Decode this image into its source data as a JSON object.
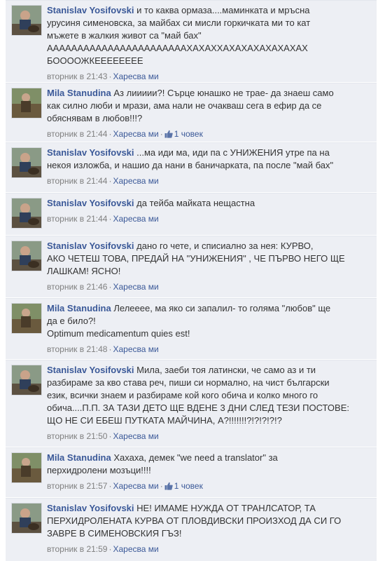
{
  "like_label": "Харесва ми",
  "comments": [
    {
      "author": "Stanislav Yosifovski",
      "lines": [
        "и то каква ормаза....маминката и мръсна",
        "урусиня сименовска, за майбах си мисли горкичката ми то кат",
        "мъжете в жалкия живот са \"май бах\"",
        "АААААААААААААААААААААААХАХАХХАХАХАХАХАХАХАХ",
        "БООООЖКЕЕЕЕЕЕЕЕ"
      ],
      "timestamp": "вторник в 21:43",
      "likes": ""
    },
    {
      "author": "Mila Stanudina",
      "lines": [
        "Аз лиииии?! Сърце юнашко не трае- да знаеш само",
        "как силно люби и мрази, ама нали не очакваш сега в ефир да се",
        "обяснявам в любов!!!?"
      ],
      "timestamp": "вторник в 21:44",
      "likes": "1 човек"
    },
    {
      "author": "Stanislav Yosifovski",
      "lines": [
        "...ма иди ма, иди па с УНИЖЕНИЯ утре па на",
        "некоя изложба, и нашио да нани в баничарката, па после \"май бах\""
      ],
      "timestamp": "вторник в 21:44",
      "likes": ""
    },
    {
      "author": "Stanislav Yosifovski",
      "lines": [
        "да тейба майката нещастна"
      ],
      "timestamp": "вторник в 21:44",
      "likes": ""
    },
    {
      "author": "Stanislav Yosifovski",
      "lines": [
        "дано го чете, и списиално за нея: КУРВО,",
        "АКО ЧЕТЕШ ТОВА, ПРЕДАЙ НА \"УНИЖЕНИЯ\" , ЧЕ ПЪРВО НЕГО ЩЕ",
        "ЛАШКАМ! ЯСНО!"
      ],
      "timestamp": "вторник в 21:46",
      "likes": ""
    },
    {
      "author": "Mila Stanudina",
      "lines": [
        "Лелееее, ма яко си запалил- то голяма \"любов\" ще",
        "да е било?!",
        "Optimum medicamentum quies est!"
      ],
      "timestamp": "вторник в 21:48",
      "likes": ""
    },
    {
      "author": "Stanislav Yosifovski",
      "lines": [
        "Мила, заеби тоя латински, че само аз и ти",
        "разбираме за кво става реч, пиши си нормално, на чист български",
        "език, всички знаем и разбираме кой кого обича и колко много го",
        "обича....П.П. ЗА ТАЗИ ДЕТО ЩЕ ВДЕНЕ 3 ДНИ СЛЕД ТЕЗИ ПОСТОВЕ:",
        "ЩО НЕ СИ ЕБЕШ ПУТКАТА МАЙЧИНА, А?!!!!!!!?!?!?!?!?"
      ],
      "timestamp": "вторник в 21:50",
      "likes": ""
    },
    {
      "author": "Mila Stanudina",
      "lines": [
        "Хахаха, демек \"we need a translator\" за",
        "перхидролени мозъци!!!!"
      ],
      "timestamp": "вторник в 21:57",
      "likes": "1 човек"
    },
    {
      "author": "Stanislav Yosifovski",
      "lines": [
        "НЕ! ИМАМЕ НУЖДА ОТ ТРАНЛСАТОР, ТА",
        "ПЕРХИДРОЛЕНАТА КУРВА ОТ ПЛОВДИВСКИ ПРОИЗХОД ДА СИ ГО",
        "ЗАВРЕ В СИМЕНОВСКИЯ ГЪЗ!"
      ],
      "timestamp": "вторник в 21:59",
      "likes": ""
    }
  ]
}
